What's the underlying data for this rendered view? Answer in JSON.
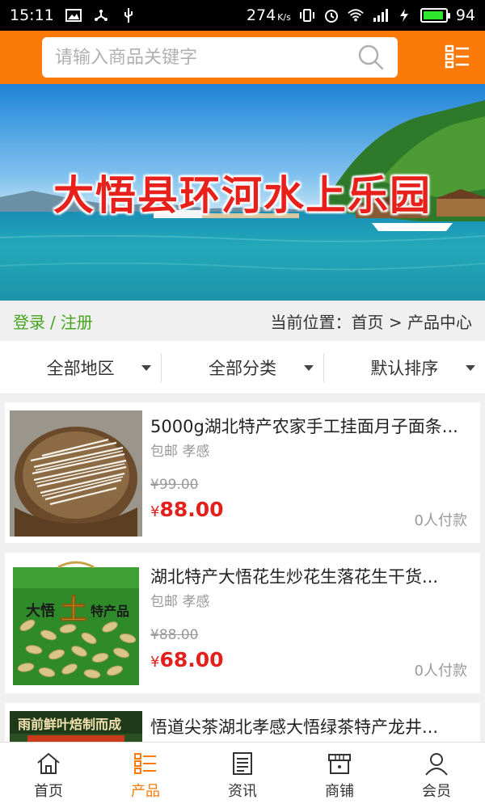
{
  "status_bar": {
    "time": "15:11",
    "speed": "274",
    "speed_unit": "K/s",
    "battery": "94",
    "battery_level": 0.94
  },
  "search": {
    "placeholder": "请输入商品关键字"
  },
  "banner": {
    "title": "大悟县环河水上乐园"
  },
  "login": {
    "login_label": "登录",
    "separator": "/",
    "register_label": "注册"
  },
  "location": {
    "text": "当前位置：首页 > 产品中心"
  },
  "filters": [
    {
      "label": "全部地区"
    },
    {
      "label": "全部分类"
    },
    {
      "label": "默认排序"
    }
  ],
  "products": [
    {
      "title": "5000g湖北特产农家手工挂面月子面条...",
      "shipping": "包邮 孝感",
      "original_price": "¥99.00",
      "currency": "¥",
      "price": "88.00",
      "paid": "0人付款"
    },
    {
      "title": "湖北特产大悟花生炒花生落花生干货...",
      "shipping": "包邮 孝感",
      "original_price": "¥88.00",
      "currency": "¥",
      "price": "68.00",
      "paid": "0人付款"
    },
    {
      "title": "悟道尖茶湖北孝感大悟绿茶特产龙井...",
      "thumb_text": "雨前鲜叶焙制而成"
    }
  ],
  "peanut_box": {
    "brand": "大悟",
    "tu": "土",
    "rest": "特产品"
  },
  "tabs": [
    {
      "label": "首页",
      "icon": "home-icon",
      "active": false
    },
    {
      "label": "产品",
      "icon": "list-icon",
      "active": true
    },
    {
      "label": "资讯",
      "icon": "news-icon",
      "active": false
    },
    {
      "label": "商铺",
      "icon": "shop-icon",
      "active": false
    },
    {
      "label": "会员",
      "icon": "user-icon",
      "active": false
    }
  ],
  "colors": {
    "accent": "#fb7a0a",
    "price": "#e3201c",
    "login": "#44a41e"
  }
}
